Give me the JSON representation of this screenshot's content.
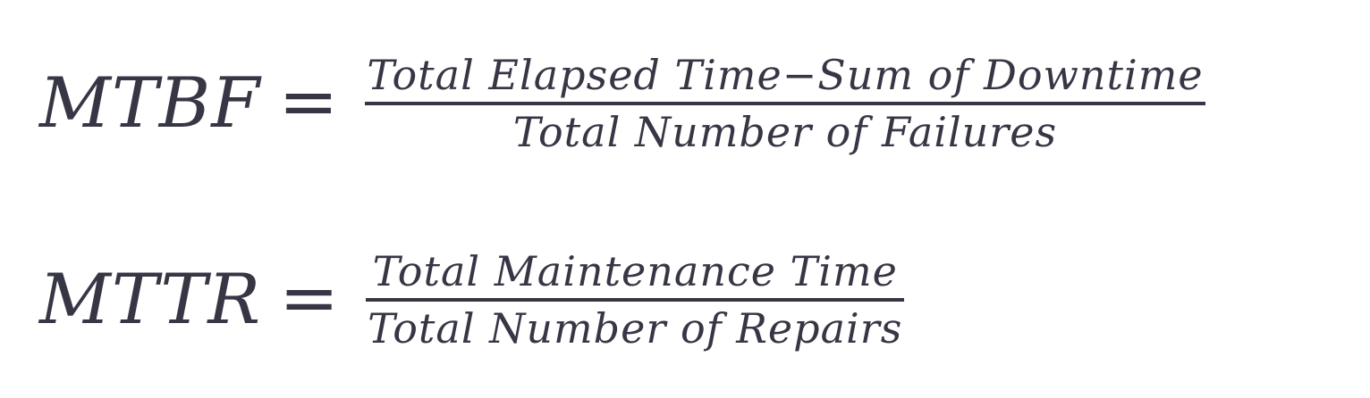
{
  "formulas": [
    {
      "lhs": "MTBF",
      "equals": "=",
      "numerator": "Total Elapsed Time−Sum of Downtime",
      "denominator": "Total Number of Failures"
    },
    {
      "lhs": "MTTR",
      "equals": "=",
      "numerator": "Total Maintenance Time",
      "denominator": "Total Number of Repairs"
    }
  ]
}
